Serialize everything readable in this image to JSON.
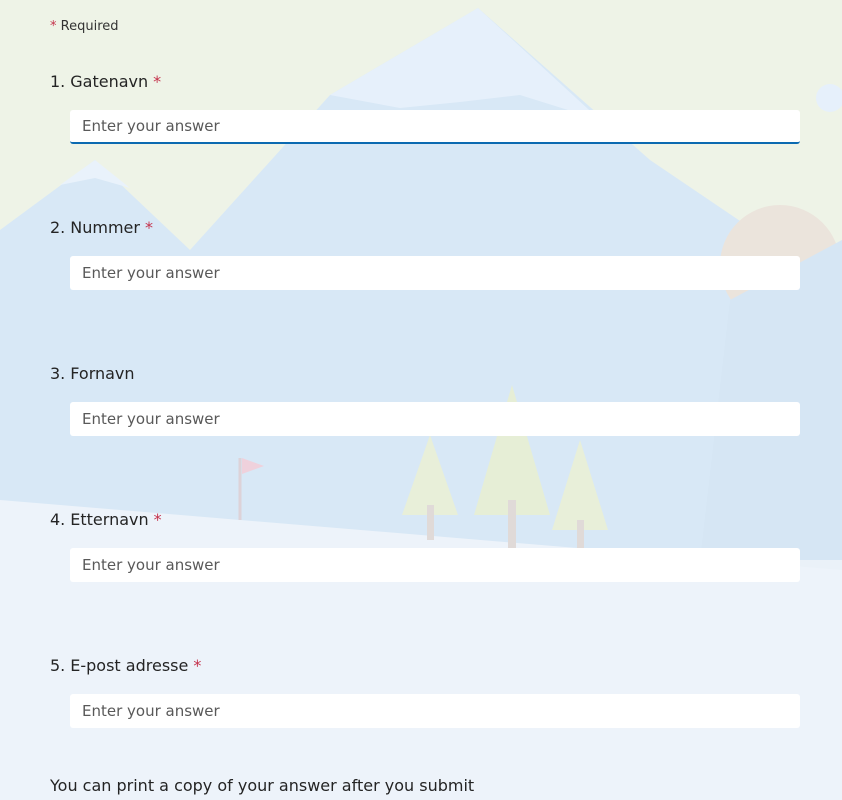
{
  "required_note": {
    "star": "*",
    "label": "Required"
  },
  "questions": [
    {
      "number": "1.",
      "title": "Gatenavn",
      "required_star": "*",
      "placeholder": "Enter your answer"
    },
    {
      "number": "2.",
      "title": "Nummer",
      "required_star": "*",
      "placeholder": "Enter your answer"
    },
    {
      "number": "3.",
      "title": "Fornavn",
      "required_star": "",
      "placeholder": "Enter your answer"
    },
    {
      "number": "4.",
      "title": "Etternavn",
      "required_star": "*",
      "placeholder": "Enter your answer"
    },
    {
      "number": "5.",
      "title": "E-post adresse",
      "required_star": "*",
      "placeholder": "Enter your answer"
    }
  ],
  "footer": {
    "text": "You can print a copy of your answer after you submit"
  },
  "colors": {
    "required": "#c4314b",
    "focus_accent": "#0b6ab1"
  }
}
